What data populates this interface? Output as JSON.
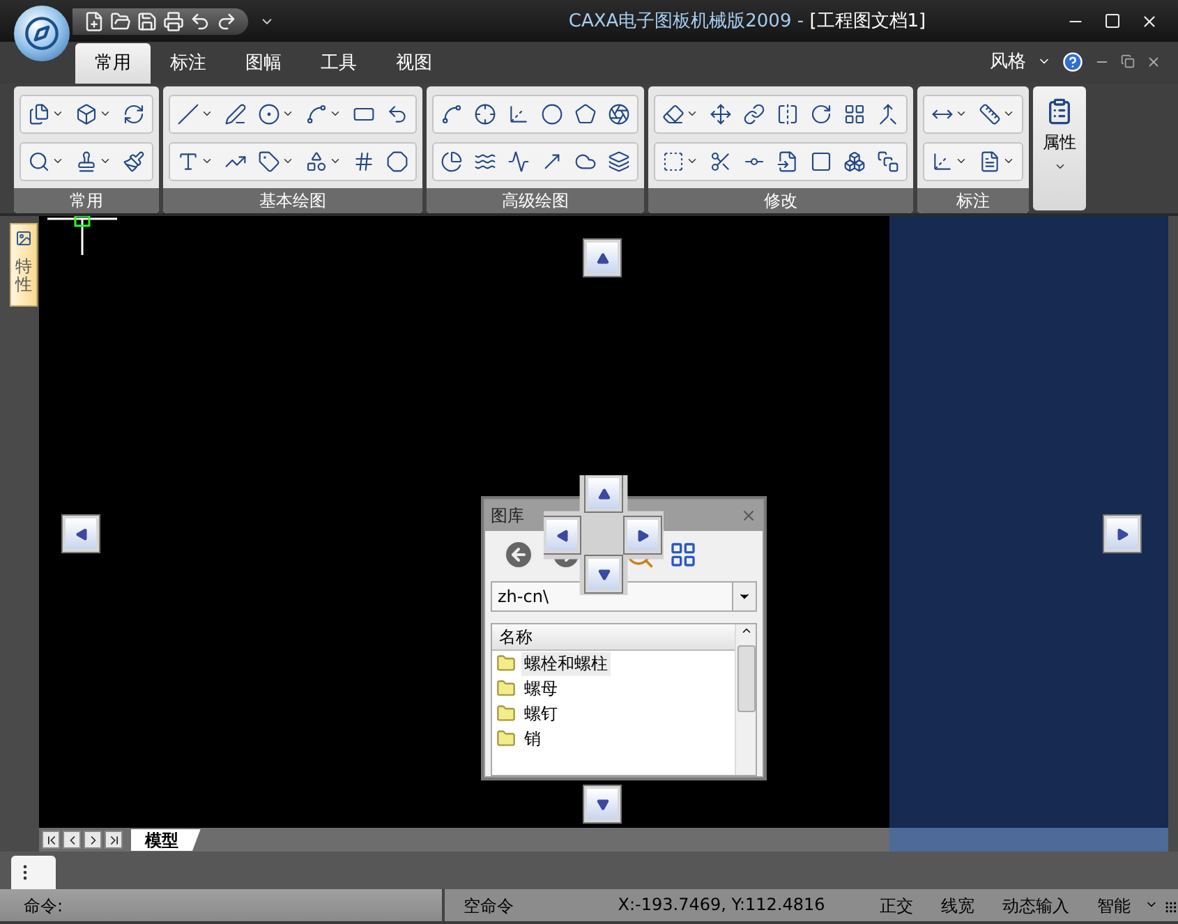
{
  "title_bar": {
    "app_title": "CAXA电子图板机械版2009 - ",
    "document": "[工程图文档1]"
  },
  "ribbon_tabs": [
    {
      "label": "常用",
      "selected": true
    },
    {
      "label": "标注",
      "selected": false
    },
    {
      "label": "图幅",
      "selected": false
    },
    {
      "label": "工具",
      "selected": false
    },
    {
      "label": "视图",
      "selected": false
    }
  ],
  "style_menu": {
    "label": "风格"
  },
  "ribbon_groups": [
    {
      "label": "常用"
    },
    {
      "label": "基本绘图"
    },
    {
      "label": "高级绘图"
    },
    {
      "label": "修改"
    },
    {
      "label": "标注"
    }
  ],
  "property_button": {
    "label": "属性"
  },
  "side_tab": {
    "label": "特性"
  },
  "library_panel": {
    "title": "图库",
    "path": "zh-cn\\",
    "column": "名称",
    "items": [
      {
        "label": "螺栓和螺柱",
        "selected": true
      },
      {
        "label": "螺母",
        "selected": false
      },
      {
        "label": "螺钉",
        "selected": false
      },
      {
        "label": "销",
        "selected": false
      }
    ]
  },
  "layout_tabs": [
    {
      "label": "模型",
      "selected": true
    }
  ],
  "command_line": {
    "label": "命令:"
  },
  "status_bar": {
    "command": "空命令",
    "coordinates": "X:-193.7469, Y:112.4816",
    "toggles": [
      {
        "label": "正交"
      },
      {
        "label": "线宽"
      },
      {
        "label": "动态输入"
      },
      {
        "label": "智能"
      }
    ]
  }
}
